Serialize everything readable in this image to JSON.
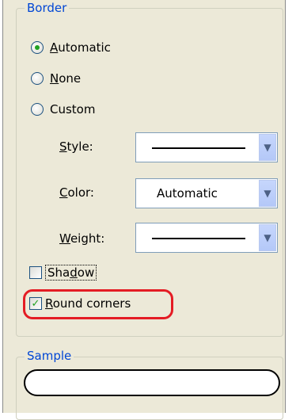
{
  "border_group": {
    "title": "Border"
  },
  "radios": [
    {
      "label": "Automatic",
      "mnemonic": "A",
      "rest": "utomatic",
      "checked": true
    },
    {
      "label": "None",
      "mnemonic": "N",
      "rest": "one",
      "checked": false
    },
    {
      "label": "Custom",
      "checked": false
    }
  ],
  "fields": {
    "style": {
      "label": "Style:",
      "mnemonic": "S",
      "rest": "tyle:",
      "value_type": "solid-line"
    },
    "color": {
      "label": "Color:",
      "mnemonic": "C",
      "rest": "olor:",
      "value": "Automatic"
    },
    "weight": {
      "label": "Weight:",
      "mnemonic": "W",
      "rest": "eight:",
      "value_type": "solid-line"
    }
  },
  "checkboxes": {
    "shadow": {
      "label": "Shadow",
      "pre": "Sha",
      "mnemonic": "d",
      "post": "ow",
      "checked": false
    },
    "round_corners": {
      "label": "Round corners",
      "mnemonic": "R",
      "rest": "ound corners",
      "checked": true
    }
  },
  "sample_group": {
    "title": "Sample"
  },
  "colors": {
    "group_title": "#0046d5",
    "highlight": "#e41c24",
    "radio_dot": "#21a121",
    "panel_bg": "#ece9d8"
  }
}
